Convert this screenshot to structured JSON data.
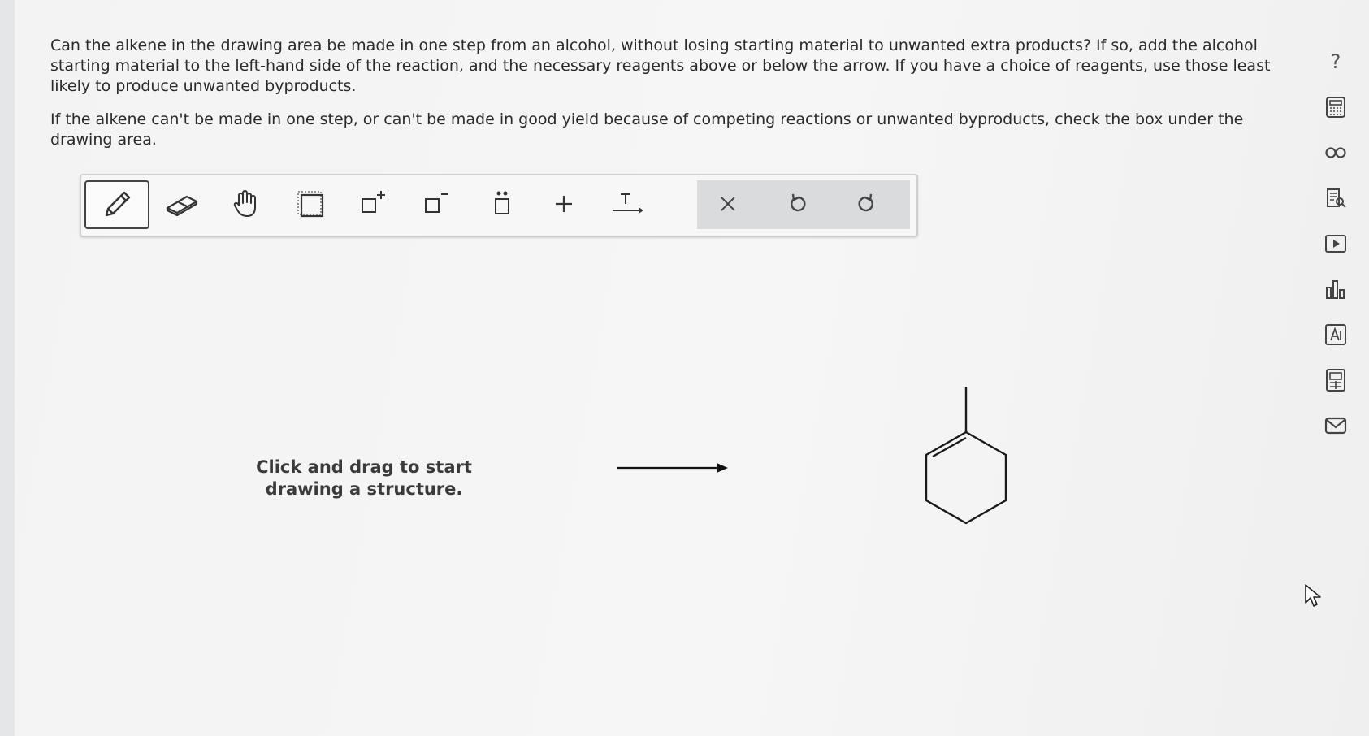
{
  "question": {
    "paragraph1": "Can the alkene in the drawing area be made in one step from an alcohol, without losing starting material to unwanted extra products? If so, add the alcohol starting material to the left-hand side of the reaction, and the necessary reagents above or below the arrow. If you have a choice of reagents, use those least likely to produce unwanted byproducts.",
    "paragraph2": "If the alkene can't be made in one step, or can't be made in good yield because of competing reactions or unwanted byproducts, check the box under the drawing area."
  },
  "toolbar": {
    "tools": [
      {
        "icon": "pencil-icon",
        "active": true
      },
      {
        "icon": "eraser-icon",
        "active": false
      },
      {
        "icon": "hand-icon",
        "active": false
      },
      {
        "icon": "select-box-icon",
        "active": false
      },
      {
        "icon": "positive-charge-icon",
        "active": false
      },
      {
        "icon": "negative-charge-icon",
        "active": false
      },
      {
        "icon": "lone-pair-icon",
        "active": false
      },
      {
        "icon": "plus-icon",
        "active": false
      },
      {
        "icon": "text-arrow-icon",
        "active": false
      }
    ],
    "actions": [
      {
        "icon": "clear-icon"
      },
      {
        "icon": "undo-icon"
      },
      {
        "icon": "redo-icon"
      }
    ]
  },
  "canvas": {
    "hint_line1": "Click and drag to start",
    "hint_line2": "drawing a structure.",
    "product": "1-methylcyclohexene"
  },
  "side_rail": {
    "help_label": "?",
    "icons": [
      "help-icon",
      "calculator-icon",
      "periodic-table-icon",
      "reading-icon",
      "video-icon",
      "data-chart-icon",
      "text-icon",
      "keyboard-icon",
      "mail-icon"
    ]
  },
  "colors": {
    "page_background": "#f4f4f4",
    "toolbar_group": "#d9dbdc",
    "ink": "#2a2a2a"
  }
}
